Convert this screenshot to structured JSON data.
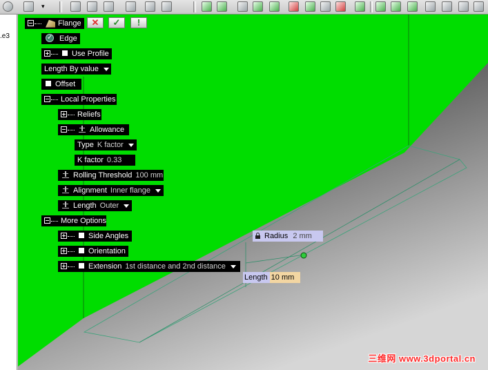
{
  "left_panel": {
    "tab_label": ".e3"
  },
  "toolbar_icons": [
    "rotate-icon",
    "box-icon",
    "dropdown-icon",
    "sketch-icon",
    "copy-icon",
    "mirror-icon",
    "wall-icon",
    "fold-icon",
    "flange-icon",
    "hem-icon",
    "tab-icon",
    "cut-icon",
    "hole-icon",
    "corner-icon",
    "relief-icon",
    "stamp-icon",
    "unfold-icon",
    "view-icon"
  ],
  "tree": {
    "flange": {
      "label": "Flange"
    },
    "edge": {
      "label": "Edge"
    },
    "use_profile": {
      "label": "Use Profile"
    },
    "length_by": {
      "label": "Length By value"
    },
    "offset": {
      "label": "Offset"
    },
    "local_properties": {
      "label": "Local Properties"
    },
    "reliefs": {
      "label": "Reliefs"
    },
    "allowance": {
      "label": "Allowance"
    },
    "type": {
      "label": "Type",
      "value": "K factor"
    },
    "k_factor": {
      "label": "K factor",
      "value": "0.33"
    },
    "rolling_threshold": {
      "label": "Rolling Threshold",
      "value": "100 mm"
    },
    "alignment": {
      "label": "Alignment",
      "value": "Inner flange"
    },
    "length": {
      "label": "Length",
      "value": "Outer"
    },
    "more_options": {
      "label": "More Options"
    },
    "side_angles": {
      "label": "Side Angles"
    },
    "orientation": {
      "label": "Orientation"
    },
    "extension": {
      "label": "Extension",
      "value": "1st distance and 2nd distance"
    }
  },
  "header_buttons": {
    "cancel": "✕",
    "ok": "✓",
    "apply": "!"
  },
  "manipulators": {
    "radius": {
      "label": "Radius",
      "value": "2 mm"
    },
    "length": {
      "label": "Length",
      "value": "10 mm"
    }
  },
  "watermark": "三维网 www.3dportal.cn",
  "colors": {
    "background_green": "#00dd00",
    "tree_bg": "#000000",
    "tag_purple": "#c8c8f0",
    "tag_orange": "#f3d6a2",
    "watermark": "#ff2a2a"
  }
}
